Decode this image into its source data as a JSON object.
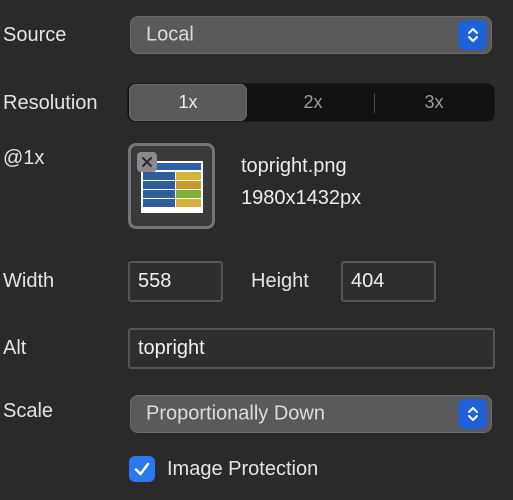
{
  "source": {
    "label": "Source",
    "value": "Local"
  },
  "resolution": {
    "label": "Resolution",
    "options": [
      "1x",
      "2x",
      "3x"
    ],
    "selected": "1x"
  },
  "image_1x": {
    "label": "@1x",
    "filename": "topright.png",
    "dimensions": "1980x1432px"
  },
  "size": {
    "width_label": "Width",
    "width_value": "558",
    "height_label": "Height",
    "height_value": "404"
  },
  "alt": {
    "label": "Alt",
    "value": "topright"
  },
  "scale": {
    "label": "Scale",
    "value": "Proportionally Down"
  },
  "image_protection": {
    "label": "Image Protection",
    "checked": true
  },
  "colors": {
    "accent": "#1f62d8",
    "checkbox": "#2b78ee",
    "background": "#2a2a2b"
  }
}
